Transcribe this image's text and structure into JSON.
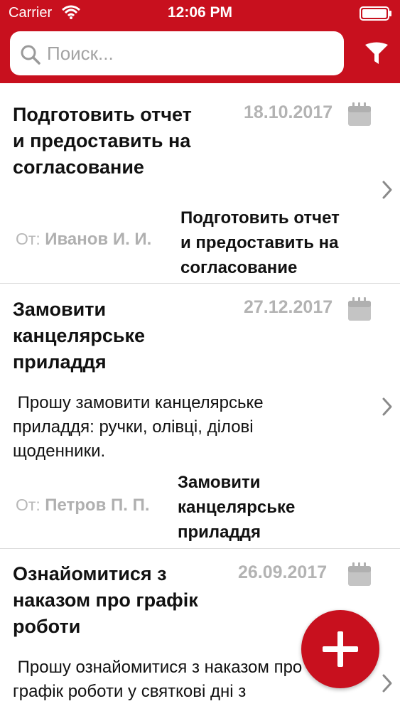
{
  "status_bar": {
    "carrier": "Carrier",
    "time": "12:06 PM"
  },
  "search": {
    "placeholder": "Поиск..."
  },
  "icons": {
    "search": "search-icon",
    "filter": "filter-icon",
    "calendar": "calendar-icon",
    "chevron": "chevron-right-icon",
    "add": "plus-icon"
  },
  "colors": {
    "brand_red": "#c8101e",
    "muted_gray": "#b3b3b3"
  },
  "tasks": [
    {
      "title_lines": [
        "Подготовить отчет",
        "и предоставить на",
        "согласование"
      ],
      "date": "18.10.2017",
      "body_lines": [],
      "from_label": "От:",
      "from_name": "Иванов И. И.",
      "subject_lines": [
        "Подготовить отчет",
        "и предоставить на",
        "согласование"
      ]
    },
    {
      "title_lines": [
        "Замовити",
        "канцелярське",
        "приладдя"
      ],
      "date": "27.12.2017",
      "body_lines": [
        " Прошу замовити канцелярське",
        "приладдя: ручки, олівці, ділові",
        "щоденники."
      ],
      "from_label": "От:",
      "from_name": "Петров П. П.",
      "subject_lines": [
        "Замовити",
        "канцелярське",
        "приладдя"
      ]
    },
    {
      "title_lines": [
        "Ознайомитися з",
        "наказом про графік",
        "роботи"
      ],
      "date": "26.09.2017",
      "body_lines": [
        " Прошу ознайомитися з наказом про",
        "графік роботи у святкові дні з"
      ],
      "from_label": "",
      "from_name": "",
      "subject_lines": []
    }
  ]
}
